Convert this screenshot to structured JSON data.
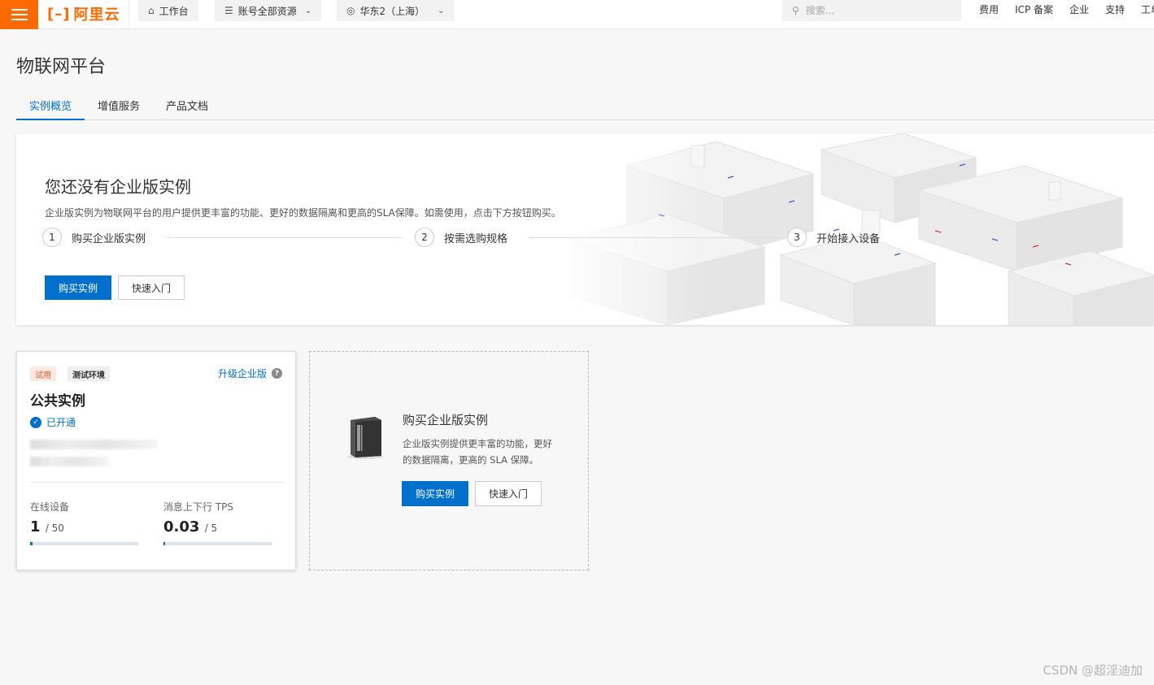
{
  "topbar": {
    "logo_text": "阿里云",
    "workbench": "工作台",
    "resources": "账号全部资源",
    "region": "华东2（上海）",
    "search_placeholder": "搜索...",
    "links": [
      "费用",
      "ICP 备案",
      "企业",
      "支持",
      "工单"
    ]
  },
  "page": {
    "title": "物联网平台",
    "tabs": [
      "实例概览",
      "增值服务",
      "产品文档"
    ]
  },
  "banner": {
    "title": "您还没有企业版实例",
    "description": "企业版实例为物联网平台的用户提供更丰富的功能、更好的数据隔离和更高的SLA保障。如需使用，点击下方按钮购买。",
    "steps": [
      {
        "num": "1",
        "label": "购买企业版实例"
      },
      {
        "num": "2",
        "label": "按需选购规格"
      },
      {
        "num": "3",
        "label": "开始接入设备"
      }
    ],
    "buy_button": "购买实例",
    "quickstart_button": "快速入门"
  },
  "instance": {
    "tag_trial": "试用",
    "tag_env": "测试环境",
    "upgrade_link": "升级企业版",
    "name": "公共实例",
    "status": "已开通",
    "metrics": [
      {
        "label": "在线设备",
        "value": "1",
        "max": "/ 50",
        "fill_fraction": 0.02
      },
      {
        "label": "消息上下行 TPS",
        "value": "0.03",
        "max": "/ 5",
        "fill_fraction": 0.006
      }
    ]
  },
  "buy_card": {
    "title": "购买企业版实例",
    "description": "企业版实例提供更丰富的功能，更好的数据隔离，更高的 SLA 保障。",
    "buy_button": "购买实例",
    "quickstart_button": "快速入门"
  },
  "watermark": "CSDN @超淫迪加",
  "colors": {
    "brand": "#ff6a00",
    "primary": "#0070cc",
    "trial_tag": "#e8572a"
  }
}
